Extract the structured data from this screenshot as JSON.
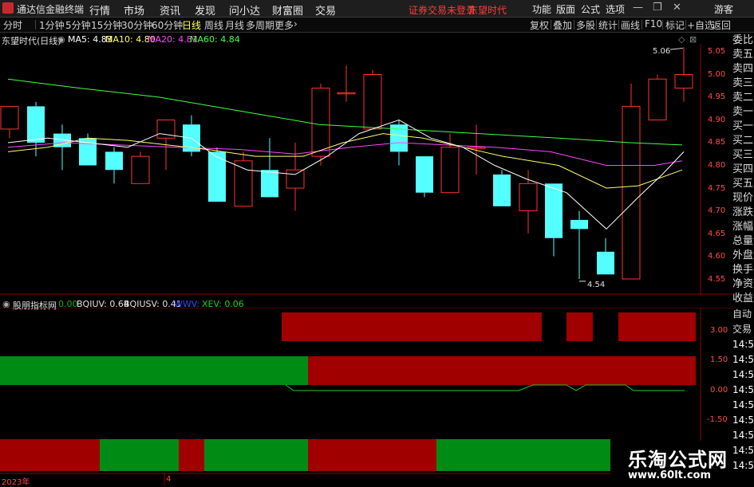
{
  "titlebar": {
    "app_name": "通达信金融终端",
    "menus": [
      "行情",
      "市场",
      "资讯",
      "发现",
      "问小达",
      "财富圈",
      "交易"
    ],
    "warning": "证券交易未登录",
    "stock_name": "东望时代",
    "right_menus": [
      "功能",
      "版面",
      "公式",
      "选项"
    ],
    "guest": "游客"
  },
  "tabs": [
    "分时",
    "1分钟",
    "5分钟",
    "15分钟",
    "30分钟",
    "60分钟",
    "日线",
    "周线",
    "月线",
    "多周期",
    "更多"
  ],
  "active_tab": "日线",
  "toolbar": [
    "复权",
    "叠加",
    "多股",
    "统计",
    "画线",
    "F10",
    "标记",
    "+自选",
    "返回"
  ],
  "main_chart": {
    "stock_label": "东望时代(日线)",
    "ma": [
      {
        "label": "MA5: 4.83",
        "color": "#ffffff"
      },
      {
        "label": "MA10: 4.80",
        "color": "#ffff66"
      },
      {
        "label": "MA20: 4.81",
        "color": "#ff44ff"
      },
      {
        "label": "MA60: 4.84",
        "color": "#44ff44"
      }
    ],
    "price_axis": [
      "5.05",
      "5.00",
      "4.95",
      "4.90",
      "4.85",
      "4.80",
      "4.75",
      "4.70",
      "4.65",
      "4.60",
      "4.55"
    ],
    "high_annotation": "5.06",
    "low_annotation": "4.54"
  },
  "sub_chart": {
    "name": "股朋指标网",
    "values": [
      {
        "label": "0.00",
        "color": "#22aa22"
      },
      {
        "label": "BQIUV: 0.64",
        "color": "#e0e0e0"
      },
      {
        "label": "BQIUSV: 0.41",
        "color": "#e0e0e0"
      },
      {
        "label": "WWV:",
        "color": "#3344ff"
      },
      {
        "label": "XEV: 0.06",
        "color": "#22cc22"
      }
    ],
    "axis": [
      "3.00",
      "1.50",
      "0.00",
      "-1.50"
    ]
  },
  "sidebar": [
    "委比",
    "卖五",
    "卖四",
    "卖三",
    "卖二",
    "卖一",
    "买一",
    "买二",
    "买三",
    "买四",
    "买五",
    "现价",
    "涨跌",
    "涨幅",
    "总量",
    "外盘",
    "换手",
    "净资",
    "收益"
  ],
  "sidebar2": [
    "自动",
    "交易",
    "14:56",
    "14:56",
    "14:56",
    "14:56",
    "14:56",
    "14:56",
    "14:56",
    "14:56",
    "14:56"
  ],
  "bottom_axis": {
    "year": "2023年",
    "month": "4"
  },
  "watermark": {
    "title": "乐淘公式网",
    "url": "www.60lt.com"
  },
  "colors": {
    "up": "#ff3232",
    "down": "#54ffff",
    "bar_red": "#a00000",
    "bar_green": "#008c14"
  }
}
